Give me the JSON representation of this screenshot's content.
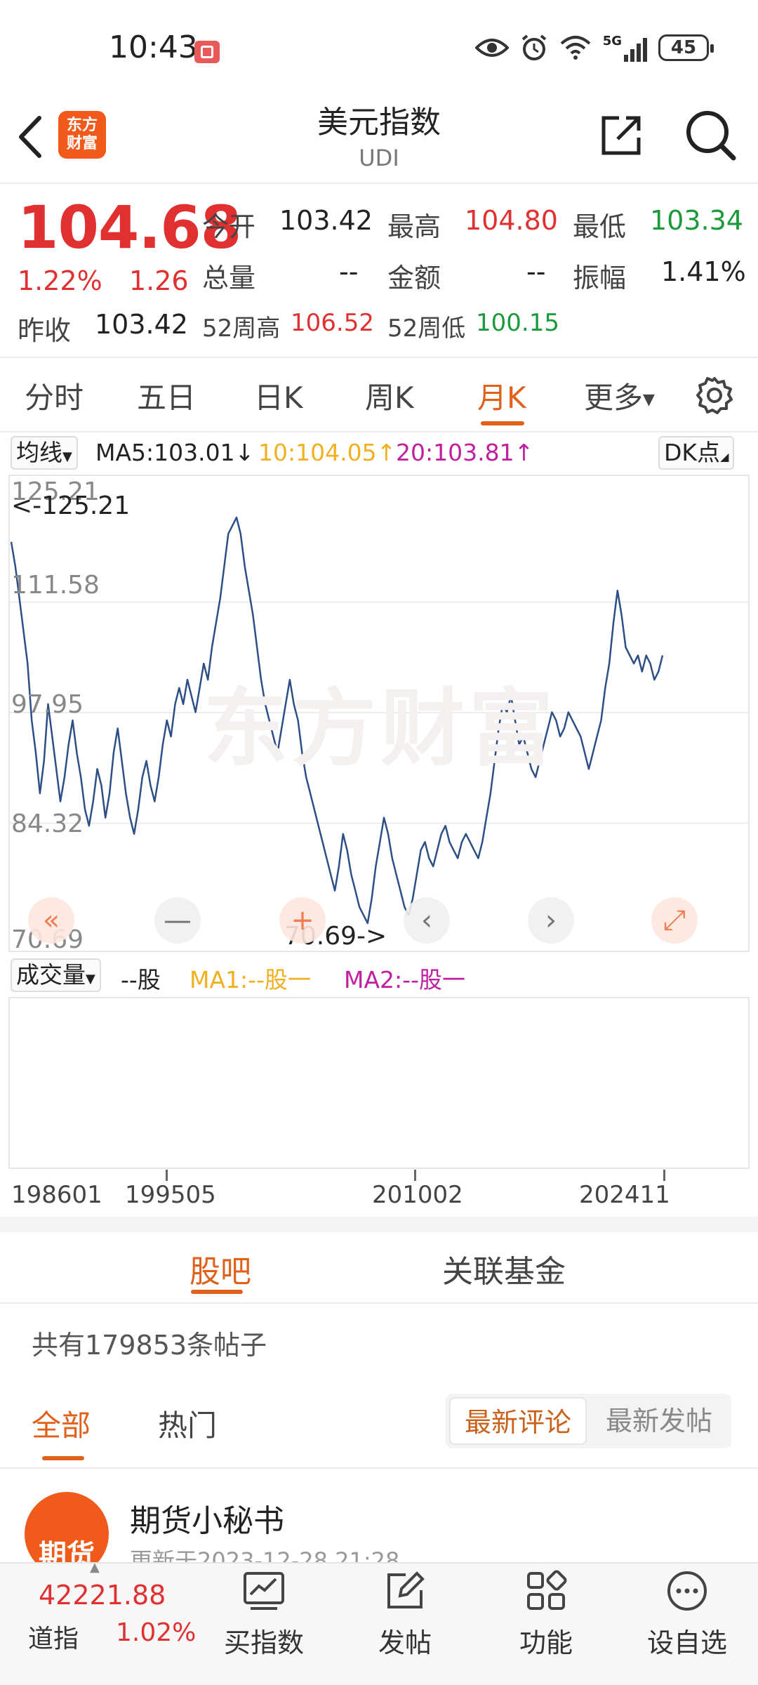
{
  "status": {
    "time": "10:43",
    "battery": "45",
    "signal_label": "5G"
  },
  "header": {
    "title": "美元指数",
    "subtitle": "UDI",
    "logo_line1": "东方",
    "logo_line2": "财富"
  },
  "quote": {
    "price": "104.68",
    "change_pct": "1.22%",
    "change": "1.26",
    "prev_close_label": "昨收",
    "prev_close": "103.42",
    "open_label": "今开",
    "open": "103.42",
    "high_label": "最高",
    "high": "104.80",
    "low_label": "最低",
    "low": "103.34",
    "volume_label": "总量",
    "volume": "--",
    "amount_label": "金额",
    "amount": "--",
    "amplitude_label": "振幅",
    "amplitude": "1.41%",
    "w52_high_label": "52周高",
    "w52_high": "106.52",
    "w52_low_label": "52周低",
    "w52_low": "100.15"
  },
  "ktabs": [
    "分时",
    "五日",
    "日K",
    "周K",
    "月K",
    "更多"
  ],
  "ktab_active": "月K",
  "ma": {
    "selector": "均线",
    "ma5": "MA5:103.01",
    "ma10": "10:104.05",
    "ma20": "20:103.81",
    "dk": "DK点",
    "colors": {
      "ma5": "#222222",
      "ma10": "#f0b020",
      "ma20": "#c020a0"
    }
  },
  "chart_data": {
    "type": "line",
    "title": "",
    "y_ticks": [
      "125.21",
      "111.58",
      "97.95",
      "84.32",
      "70.69"
    ],
    "ylim": [
      70.69,
      125.21
    ],
    "max_label": "<-125.21",
    "min_label": "70.69->",
    "x_ticks": [
      "198601",
      "199505",
      "201002",
      "202411"
    ],
    "line_color": "#2d4f86",
    "series": [
      {
        "values": [
          119,
          116,
          112,
          108,
          104,
          97,
          93,
          88,
          92,
          99,
          95,
          91,
          87,
          90,
          94,
          97,
          93,
          90,
          86,
          84,
          87,
          91,
          89,
          85,
          88,
          93,
          96,
          92,
          88,
          85,
          83,
          86,
          90,
          92,
          89,
          87,
          90,
          94,
          97,
          95,
          99,
          101,
          99,
          102,
          100,
          98,
          101,
          104,
          102,
          106,
          109,
          112,
          116,
          120,
          121,
          122,
          120,
          116,
          113,
          110,
          106,
          102,
          99,
          97,
          95,
          93,
          96,
          99,
          102,
          99,
          97,
          93,
          90,
          88,
          86,
          84,
          82,
          80,
          78,
          76,
          79,
          83,
          81,
          78,
          76,
          74,
          73,
          72,
          75,
          79,
          82,
          85,
          83,
          80,
          78,
          76,
          74,
          73,
          75,
          78,
          81,
          82,
          80,
          79,
          81,
          83,
          84,
          82,
          81,
          80,
          82,
          83,
          82,
          81,
          80,
          82,
          85,
          88,
          92,
          96,
          99,
          98,
          100,
          97,
          94,
          95,
          93,
          91,
          90,
          92,
          94,
          96,
          98,
          97,
          95,
          96,
          98,
          97,
          96,
          95,
          93,
          91,
          93,
          95,
          97,
          101,
          104,
          109,
          113,
          110,
          106,
          105,
          104,
          105,
          103,
          105,
          104,
          102,
          103,
          105
        ]
      }
    ]
  },
  "controls": [
    "«",
    "—",
    "+",
    "‹",
    "›",
    "⤢"
  ],
  "volume": {
    "selector": "成交量",
    "unit": "--股",
    "ma1": "MA1:--股一",
    "ma2": "MA2:--股一"
  },
  "community": {
    "tabs": [
      "股吧",
      "关联基金"
    ],
    "post_count": "共有179853条帖子",
    "sub_tabs": [
      "全部",
      "热门"
    ],
    "sort": [
      "最新评论",
      "最新发帖"
    ],
    "post": {
      "author": "期货小秘书",
      "avatar_text": "期货",
      "time": "更新于2023-12-28 21:28"
    }
  },
  "bottom_nav": {
    "index_value": "42221.88",
    "index_name": "道指",
    "index_change": "1.02%",
    "items": [
      "买指数",
      "发帖",
      "功能",
      "设自选"
    ]
  }
}
